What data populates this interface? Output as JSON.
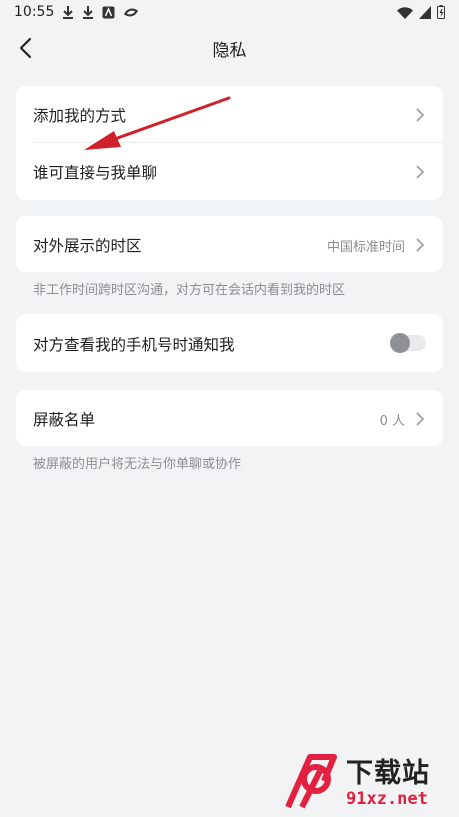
{
  "status_bar": {
    "time": "10:55",
    "left_icons": [
      "download-icon",
      "download-icon",
      "app-icon",
      "recycle-icon"
    ],
    "right_icons": [
      "wifi-icon",
      "signal-icon",
      "battery-icon"
    ]
  },
  "header": {
    "title": "隐私",
    "back_icon": "chevron-left-icon"
  },
  "sections": {
    "contact": {
      "add_me_label": "添加我的方式",
      "direct_chat_label": "谁可直接与我单聊"
    },
    "timezone": {
      "label": "对外展示的时区",
      "value": "中国标准时间",
      "hint": "非工作时间跨时区沟通，对方可在会话内看到我的时区"
    },
    "phone_notify": {
      "label": "对方查看我的手机号时通知我",
      "enabled": false
    },
    "blocklist": {
      "label": "屏蔽名单",
      "value": "0 人",
      "hint": "被屏蔽的用户将无法与你单聊或协作"
    }
  },
  "annotation": {
    "arrow_color": "#d0202a"
  },
  "watermark": {
    "logo_text": "9",
    "title": "下载站",
    "url": "91xz.net"
  }
}
